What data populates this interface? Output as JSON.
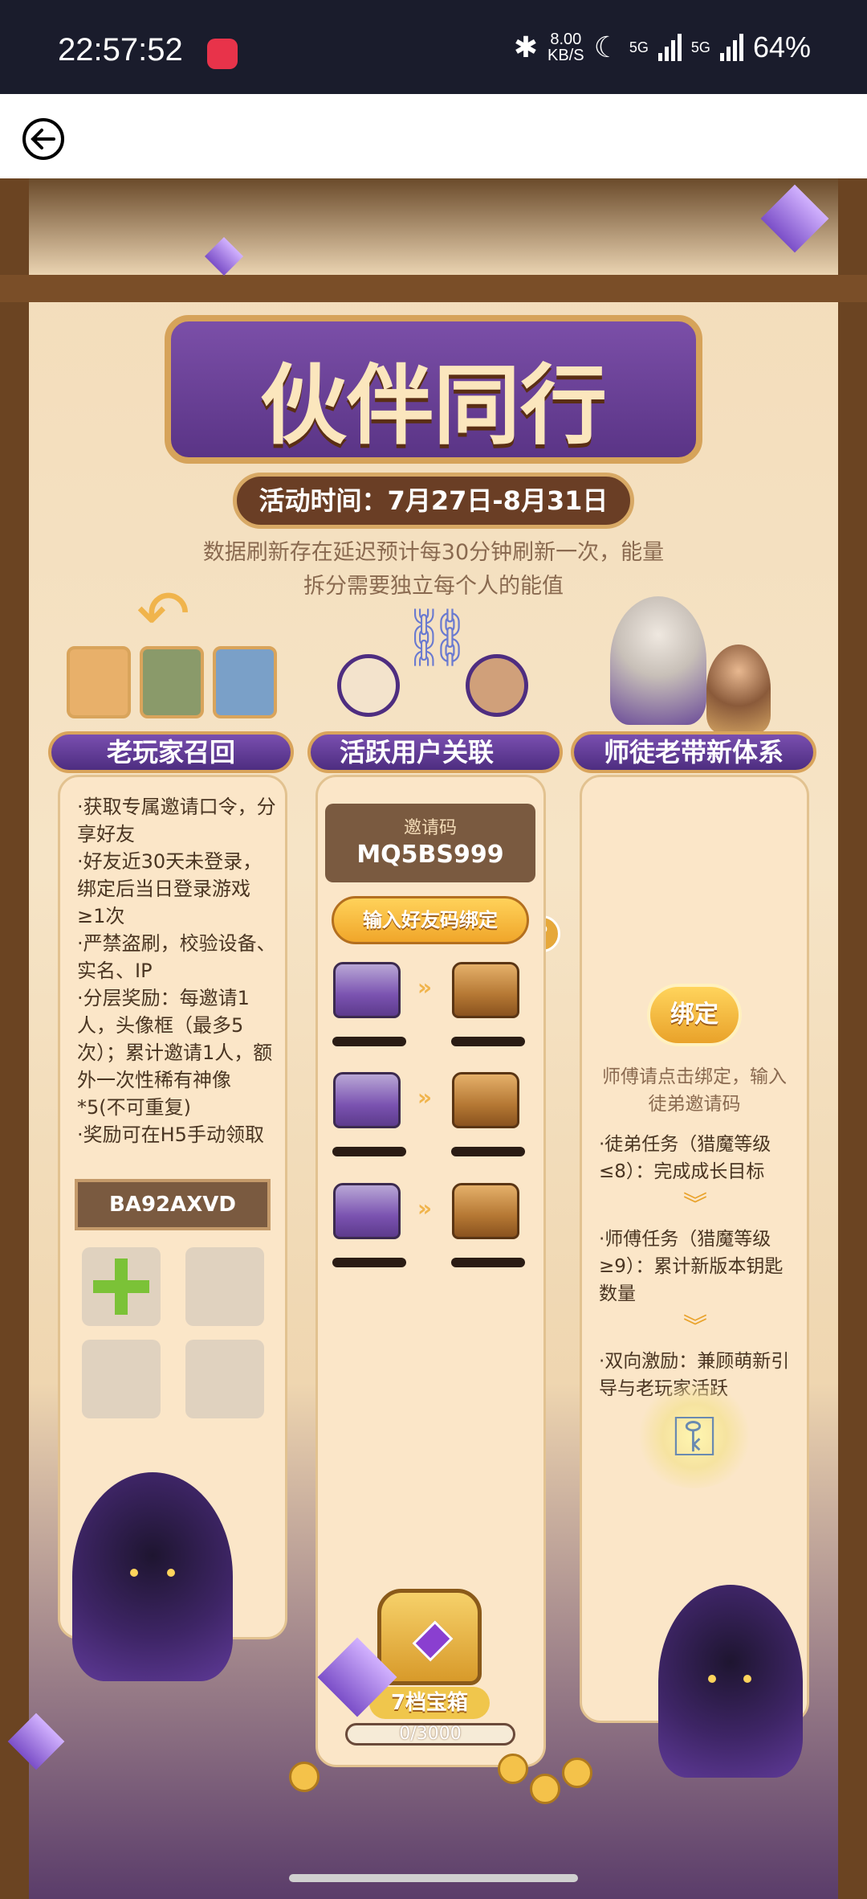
{
  "status_bar": {
    "time": "22:57:52",
    "net_speed_value": "8.00",
    "net_speed_unit": "KB/S",
    "signal1": "5G",
    "signal2": "5G",
    "battery": "64%"
  },
  "banner": {
    "title": "伙伴同行",
    "date": "活动时间：7月27日-8月31日",
    "notice": "数据刷新存在延迟预计每30分钟刷新一次，能量拆分需要独立每个人的能值"
  },
  "col1": {
    "title": "老玩家召回",
    "rules": [
      "·获取专属邀请口令，分享好友",
      "·好友近30天未登录，绑定后当日登录游戏≥1次",
      "·严禁盗刷，校验设备、实名、IP",
      "·分层奖励：每邀请1人，头像框（最多5次）；累计邀请1人，额外一次性稀有神像*5(不可重复)",
      "·奖励可在H5手动领取"
    ],
    "code": "BA92AXVD"
  },
  "col2": {
    "title": "活跃用户关联",
    "help": "?",
    "invite_label": "邀请码",
    "invite_code": "MQ5BS999",
    "bind_friend": "输入好友码绑定",
    "tier": "7档宝箱",
    "progress_text": "0/3000",
    "progress": 0
  },
  "col3": {
    "title": "师徒老带新体系",
    "bind": "绑定",
    "hint": "师傅请点击绑定，输入徒弟邀请码",
    "task1": "·徒弟任务（猎魔等级≤8）：完成成长目标",
    "task2": "·师傅任务（猎魔等级≥9）：累计新版本钥匙数量",
    "task3": "·双向激励：兼顾萌新引导与老玩家活跃"
  },
  "colors": {
    "accent_purple": "#5a3486",
    "accent_gold": "#e9a22a",
    "wood": "#6b4422"
  }
}
